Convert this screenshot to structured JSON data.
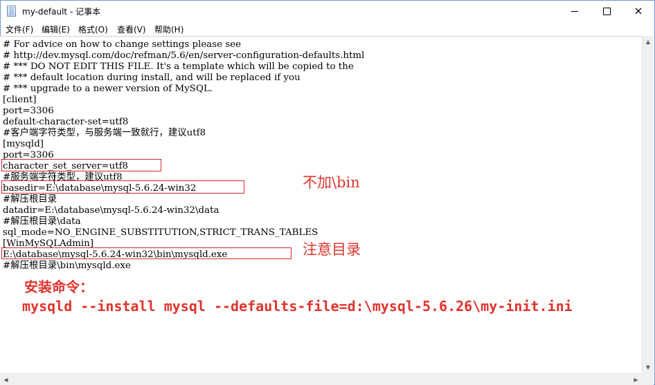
{
  "window": {
    "title": "my-default - 记事本",
    "icon": "notepad-icon",
    "controls": {
      "minimize": "minimize-icon",
      "maximize": "maximize-icon",
      "close": "×"
    }
  },
  "menu": [
    {
      "label": "文件(F)"
    },
    {
      "label": "编辑(E)"
    },
    {
      "label": "格式(O)"
    },
    {
      "label": "查看(V)"
    },
    {
      "label": "帮助(H)"
    }
  ],
  "editor": {
    "lines": [
      "# For advice on how to change settings please see",
      "# http://dev.mysql.com/doc/refman/5.6/en/server-configuration-defaults.html",
      "# *** DO NOT EDIT THIS FILE. It's a template which will be copied to the",
      "# *** default location during install, and will be replaced if you",
      "# *** upgrade to a newer version of MySQL.",
      "[client]",
      "port=3306",
      "default-character-set=utf8",
      "#客户端字符类型，与服务端一致就行，建议utf8",
      "[mysqld]",
      "port=3306",
      "character_set_server=utf8",
      "#服务端字符类型，建议utf8",
      "basedir=E:\\database\\mysql-5.6.24-win32",
      "#解压根目录",
      "datadir=E:\\database\\mysql-5.6.24-win32\\data",
      "#解压根目录\\data",
      "sql_mode=NO_ENGINE_SUBSTITUTION,STRICT_TRANS_TABLES",
      "[WinMySQLAdmin]",
      "E:\\database\\mysql-5.6.24-win32\\bin\\mysqld.exe",
      "#解压根目录\\bin\\mysqld.exe"
    ]
  },
  "annotations": {
    "basedir_note": "不加\\bin",
    "path_note": "注意目录",
    "install_label": "安装命令：",
    "install_command": "mysqld --install mysql --defaults-file=d:\\mysql-5.6.26\\my-init.ini",
    "color": "#e0332b"
  },
  "scrollbars": {
    "up": "▲",
    "down": "▼",
    "left": "◀",
    "right": "▶"
  }
}
